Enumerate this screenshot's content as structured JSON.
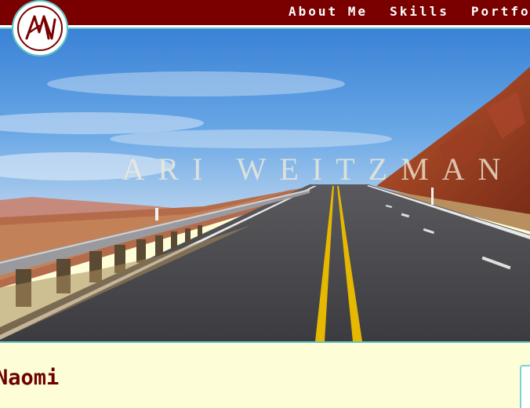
{
  "nav": {
    "items": [
      "About Me",
      "Skills",
      "Portfolio"
    ]
  },
  "logo": {
    "monogram": "AW",
    "icon": "aw-monogram-logo",
    "color": "#7a0000"
  },
  "hero": {
    "title": "ARI WEITZMAN",
    "image": "desert-highway-photo"
  },
  "content": {
    "heading": "Naomi"
  },
  "colors": {
    "nav_bg": "#7a0000",
    "accent": "#5fc4c4",
    "content_bg": "#fdfed8",
    "heading": "#6b0000"
  }
}
